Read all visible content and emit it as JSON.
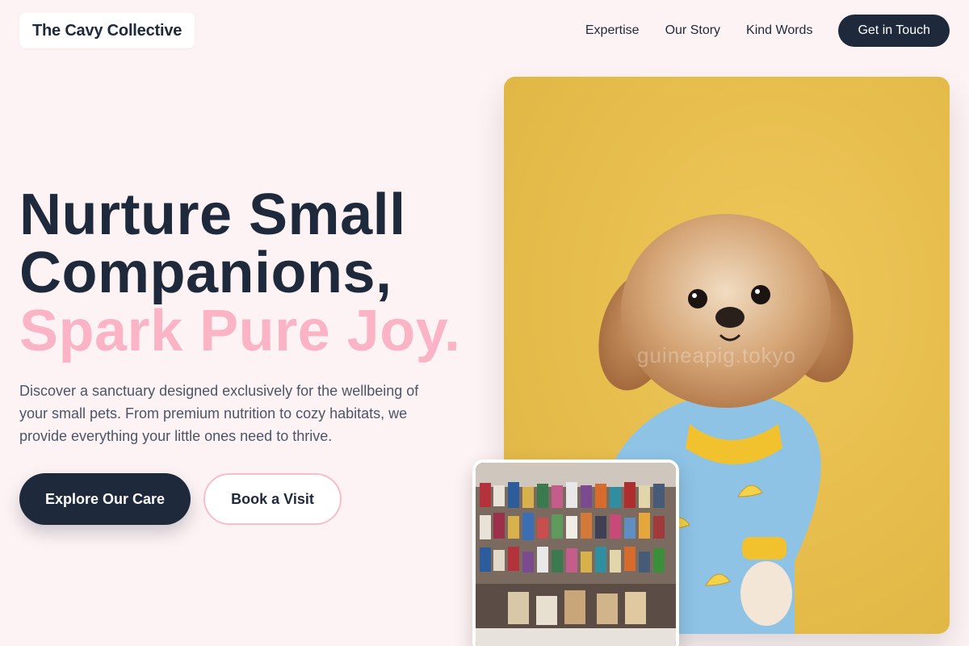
{
  "header": {
    "brand": "The Cavy Collective",
    "nav": [
      {
        "label": "Expertise"
      },
      {
        "label": "Our Story"
      },
      {
        "label": "Kind Words"
      }
    ],
    "cta_label": "Get in Touch"
  },
  "hero": {
    "title_lines": [
      "Nurture Small",
      "Companions,"
    ],
    "title_accent": "Spark Pure Joy.",
    "description": "Discover a sanctuary designed exclusively for the wellbeing of your small pets. From premium nutrition to cozy habitats, we provide everything your little ones need to thrive.",
    "primary_button": "Explore Our Care",
    "secondary_button": "Book a Visit"
  },
  "images": {
    "main_watermark": "guineapig.tokyo"
  },
  "colors": {
    "brand_navy": "#1e293b",
    "accent_pink": "#fbb4c6",
    "background": "#fdf3f4",
    "photo_yellow": "#e6bd4c"
  },
  "icons": {
    "main_photo": "dog-in-banana-shirt-photo",
    "inset_photo": "pet-shop-shelves-photo"
  }
}
